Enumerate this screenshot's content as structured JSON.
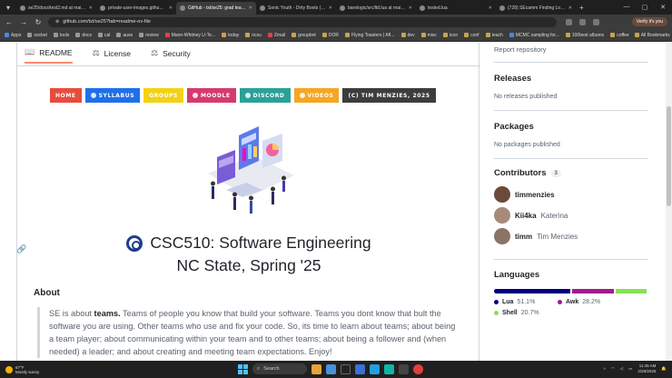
{
  "browser": {
    "tabs": [
      {
        "title": "se25/docs/test2.md at main - ti",
        "active": false
      },
      {
        "title": "private-user-images.githubuse",
        "active": false
      },
      {
        "title": "GitHub - txt/se25: grad teachin",
        "active": true
      },
      {
        "title": "Sonic Youth - Dirty Boots (Rem",
        "active": false
      },
      {
        "title": "barelogic/src/ltd.lua at main - t",
        "active": false
      },
      {
        "title": "tested.lua",
        "active": false
      },
      {
        "title": "(728) SEcamm Finding Logic -",
        "active": false
      }
    ],
    "url": "github.com/txt/se25?tab=readme-ov-file",
    "profile_label": "Verify it's you",
    "bookmarks": [
      "Apps",
      "socket",
      "tools",
      "docs",
      "cal",
      "ause",
      "review",
      "Mann-Whitney U-Te...",
      "today",
      "ncsu",
      "Zmail",
      "groupbot",
      "DOR",
      "Flying Toasters | AfI...",
      "dev",
      "misc",
      "icon",
      "conf",
      "teach",
      "MCMC sampling for...",
      "100best albums",
      "coffee"
    ],
    "all_bookmarks": "All Bookmarks"
  },
  "readme_tabs": [
    {
      "label": "README",
      "icon": "book-icon"
    },
    {
      "label": "License",
      "icon": "scale-icon"
    },
    {
      "label": "Security",
      "icon": "scale-icon"
    }
  ],
  "badges": [
    {
      "label": "Home",
      "color": "#e84c3d",
      "icon": ""
    },
    {
      "label": "Syllabus",
      "color": "#1f6feb",
      "icon": "syllabus-icon"
    },
    {
      "label": "Groups",
      "color": "#f3d214",
      "icon": ""
    },
    {
      "label": "Moodle",
      "color": "#d63a6e",
      "icon": "moodle-icon"
    },
    {
      "label": "Discord",
      "color": "#2aa198",
      "icon": "discord-icon"
    },
    {
      "label": "Videos",
      "color": "#f5a623",
      "icon": "video-icon"
    },
    {
      "label": "(c) Tim Menzies, 2025",
      "color": "#3d3d3d",
      "icon": ""
    }
  ],
  "readme": {
    "title_line1": "CSC510: Software Engineering",
    "title_line2": "NC State, Spring '25",
    "about_heading": "About",
    "about_intro": "SE is about ",
    "about_bold": "teams.",
    "about_rest": " Teams of people you know that build your software. Teams you dont know that bult the software you are using. Other teams who use and fix your code. So, its time to learn about teams; about being a team player; about communicating within your team and to other teams; about being a follower and (when needed) a leader; and about creating and meeting team expectations. Enjoy!"
  },
  "sidebar": {
    "report": "Report repository",
    "releases": {
      "title": "Releases",
      "empty": "No releases published"
    },
    "packages": {
      "title": "Packages",
      "empty": "No packages published"
    },
    "contributors": {
      "title": "Contributors",
      "count": "3",
      "list": [
        {
          "login": "timmenzies",
          "name": "",
          "color": "#6b4a3a"
        },
        {
          "login": "Kii4ka",
          "name": "Katerina",
          "color": "#a88a78"
        },
        {
          "login": "timm",
          "name": "Tim Menzies",
          "color": "#8a7466"
        }
      ]
    },
    "languages": {
      "title": "Languages",
      "items": [
        {
          "name": "Lua",
          "percent": "51.1%",
          "value": 51.1,
          "color": "#000080"
        },
        {
          "name": "Awk",
          "percent": "28.2%",
          "value": 28.2,
          "color": "#a31a8f"
        },
        {
          "name": "Shell",
          "percent": "20.7%",
          "value": 20.7,
          "color": "#89e051"
        }
      ]
    }
  },
  "taskbar": {
    "weather_temp": "67°F",
    "weather_desc": "Mostly sunny",
    "search_label": "Search",
    "time": "11:45 AM",
    "date": "2/26/2025"
  }
}
